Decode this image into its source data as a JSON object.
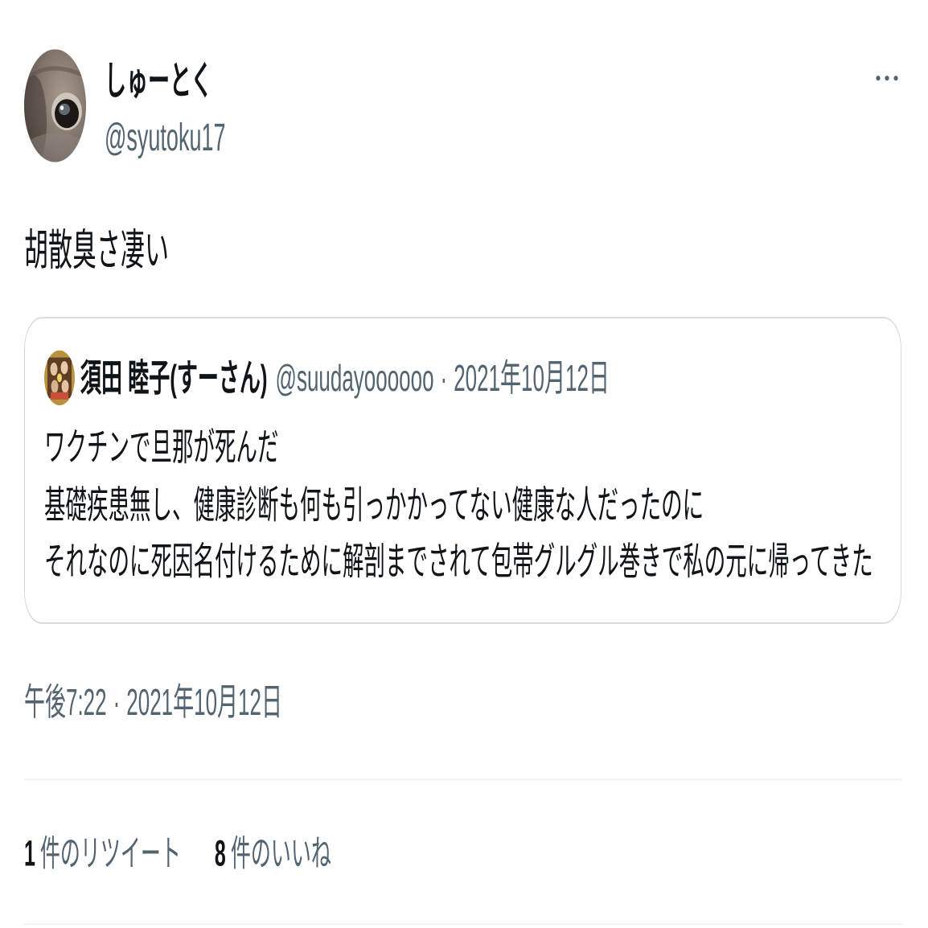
{
  "tweet": {
    "author": {
      "display_name": "しゅーとく",
      "handle": "@syutoku17"
    },
    "text": "胡散臭さ凄い",
    "quoted_tweet": {
      "author": {
        "display_name": "須田 睦子(すーさん)",
        "handle": "@suudayoooooo"
      },
      "separator": "·",
      "date": "2021年10月12日",
      "lines": [
        "ワクチンで旦那が死んだ",
        "基礎疾患無し、健康診断も何も引っかかってない健康な人だったのに",
        "それなのに死因名付けるために解剖までされて包帯グルグル巻きで私の元に帰ってきた"
      ]
    },
    "timestamp": {
      "time": "午後7:22",
      "separator": "·",
      "date": "2021年10月12日"
    },
    "stats": [
      {
        "count": "1",
        "label": "件のリツイート"
      },
      {
        "count": "8",
        "label": "件のいいね"
      }
    ]
  },
  "icons": {
    "more": "more-horizontal-icon"
  },
  "colors": {
    "text_primary": "#0f1419",
    "text_secondary": "#536471",
    "card_border": "#cfd9de",
    "divider": "#eff3f4",
    "background": "#ffffff"
  }
}
